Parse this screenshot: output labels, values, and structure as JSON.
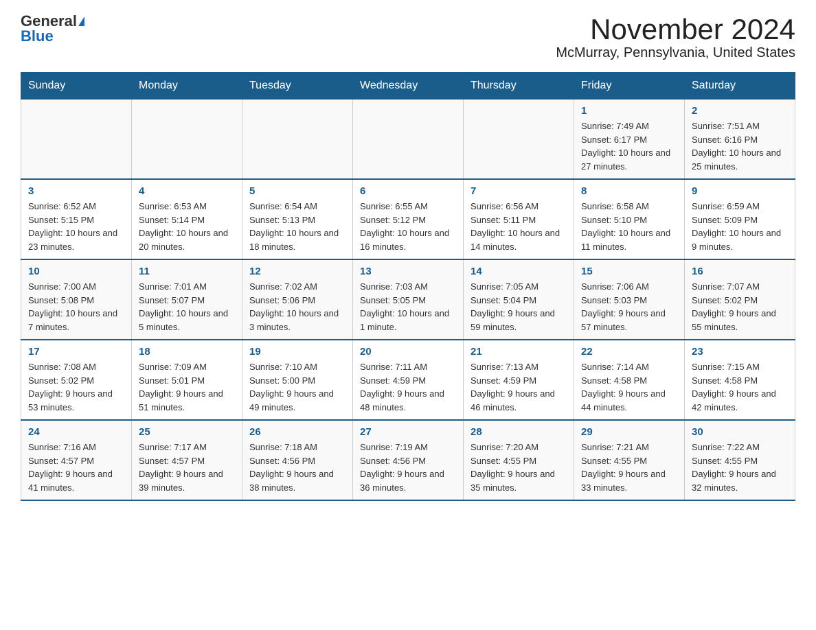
{
  "logo": {
    "general": "General",
    "blue": "Blue"
  },
  "title": "November 2024",
  "subtitle": "McMurray, Pennsylvania, United States",
  "days_of_week": [
    "Sunday",
    "Monday",
    "Tuesday",
    "Wednesday",
    "Thursday",
    "Friday",
    "Saturday"
  ],
  "weeks": [
    [
      {
        "day": "",
        "info": ""
      },
      {
        "day": "",
        "info": ""
      },
      {
        "day": "",
        "info": ""
      },
      {
        "day": "",
        "info": ""
      },
      {
        "day": "",
        "info": ""
      },
      {
        "day": "1",
        "info": "Sunrise: 7:49 AM\nSunset: 6:17 PM\nDaylight: 10 hours and 27 minutes."
      },
      {
        "day": "2",
        "info": "Sunrise: 7:51 AM\nSunset: 6:16 PM\nDaylight: 10 hours and 25 minutes."
      }
    ],
    [
      {
        "day": "3",
        "info": "Sunrise: 6:52 AM\nSunset: 5:15 PM\nDaylight: 10 hours and 23 minutes."
      },
      {
        "day": "4",
        "info": "Sunrise: 6:53 AM\nSunset: 5:14 PM\nDaylight: 10 hours and 20 minutes."
      },
      {
        "day": "5",
        "info": "Sunrise: 6:54 AM\nSunset: 5:13 PM\nDaylight: 10 hours and 18 minutes."
      },
      {
        "day": "6",
        "info": "Sunrise: 6:55 AM\nSunset: 5:12 PM\nDaylight: 10 hours and 16 minutes."
      },
      {
        "day": "7",
        "info": "Sunrise: 6:56 AM\nSunset: 5:11 PM\nDaylight: 10 hours and 14 minutes."
      },
      {
        "day": "8",
        "info": "Sunrise: 6:58 AM\nSunset: 5:10 PM\nDaylight: 10 hours and 11 minutes."
      },
      {
        "day": "9",
        "info": "Sunrise: 6:59 AM\nSunset: 5:09 PM\nDaylight: 10 hours and 9 minutes."
      }
    ],
    [
      {
        "day": "10",
        "info": "Sunrise: 7:00 AM\nSunset: 5:08 PM\nDaylight: 10 hours and 7 minutes."
      },
      {
        "day": "11",
        "info": "Sunrise: 7:01 AM\nSunset: 5:07 PM\nDaylight: 10 hours and 5 minutes."
      },
      {
        "day": "12",
        "info": "Sunrise: 7:02 AM\nSunset: 5:06 PM\nDaylight: 10 hours and 3 minutes."
      },
      {
        "day": "13",
        "info": "Sunrise: 7:03 AM\nSunset: 5:05 PM\nDaylight: 10 hours and 1 minute."
      },
      {
        "day": "14",
        "info": "Sunrise: 7:05 AM\nSunset: 5:04 PM\nDaylight: 9 hours and 59 minutes."
      },
      {
        "day": "15",
        "info": "Sunrise: 7:06 AM\nSunset: 5:03 PM\nDaylight: 9 hours and 57 minutes."
      },
      {
        "day": "16",
        "info": "Sunrise: 7:07 AM\nSunset: 5:02 PM\nDaylight: 9 hours and 55 minutes."
      }
    ],
    [
      {
        "day": "17",
        "info": "Sunrise: 7:08 AM\nSunset: 5:02 PM\nDaylight: 9 hours and 53 minutes."
      },
      {
        "day": "18",
        "info": "Sunrise: 7:09 AM\nSunset: 5:01 PM\nDaylight: 9 hours and 51 minutes."
      },
      {
        "day": "19",
        "info": "Sunrise: 7:10 AM\nSunset: 5:00 PM\nDaylight: 9 hours and 49 minutes."
      },
      {
        "day": "20",
        "info": "Sunrise: 7:11 AM\nSunset: 4:59 PM\nDaylight: 9 hours and 48 minutes."
      },
      {
        "day": "21",
        "info": "Sunrise: 7:13 AM\nSunset: 4:59 PM\nDaylight: 9 hours and 46 minutes."
      },
      {
        "day": "22",
        "info": "Sunrise: 7:14 AM\nSunset: 4:58 PM\nDaylight: 9 hours and 44 minutes."
      },
      {
        "day": "23",
        "info": "Sunrise: 7:15 AM\nSunset: 4:58 PM\nDaylight: 9 hours and 42 minutes."
      }
    ],
    [
      {
        "day": "24",
        "info": "Sunrise: 7:16 AM\nSunset: 4:57 PM\nDaylight: 9 hours and 41 minutes."
      },
      {
        "day": "25",
        "info": "Sunrise: 7:17 AM\nSunset: 4:57 PM\nDaylight: 9 hours and 39 minutes."
      },
      {
        "day": "26",
        "info": "Sunrise: 7:18 AM\nSunset: 4:56 PM\nDaylight: 9 hours and 38 minutes."
      },
      {
        "day": "27",
        "info": "Sunrise: 7:19 AM\nSunset: 4:56 PM\nDaylight: 9 hours and 36 minutes."
      },
      {
        "day": "28",
        "info": "Sunrise: 7:20 AM\nSunset: 4:55 PM\nDaylight: 9 hours and 35 minutes."
      },
      {
        "day": "29",
        "info": "Sunrise: 7:21 AM\nSunset: 4:55 PM\nDaylight: 9 hours and 33 minutes."
      },
      {
        "day": "30",
        "info": "Sunrise: 7:22 AM\nSunset: 4:55 PM\nDaylight: 9 hours and 32 minutes."
      }
    ]
  ]
}
